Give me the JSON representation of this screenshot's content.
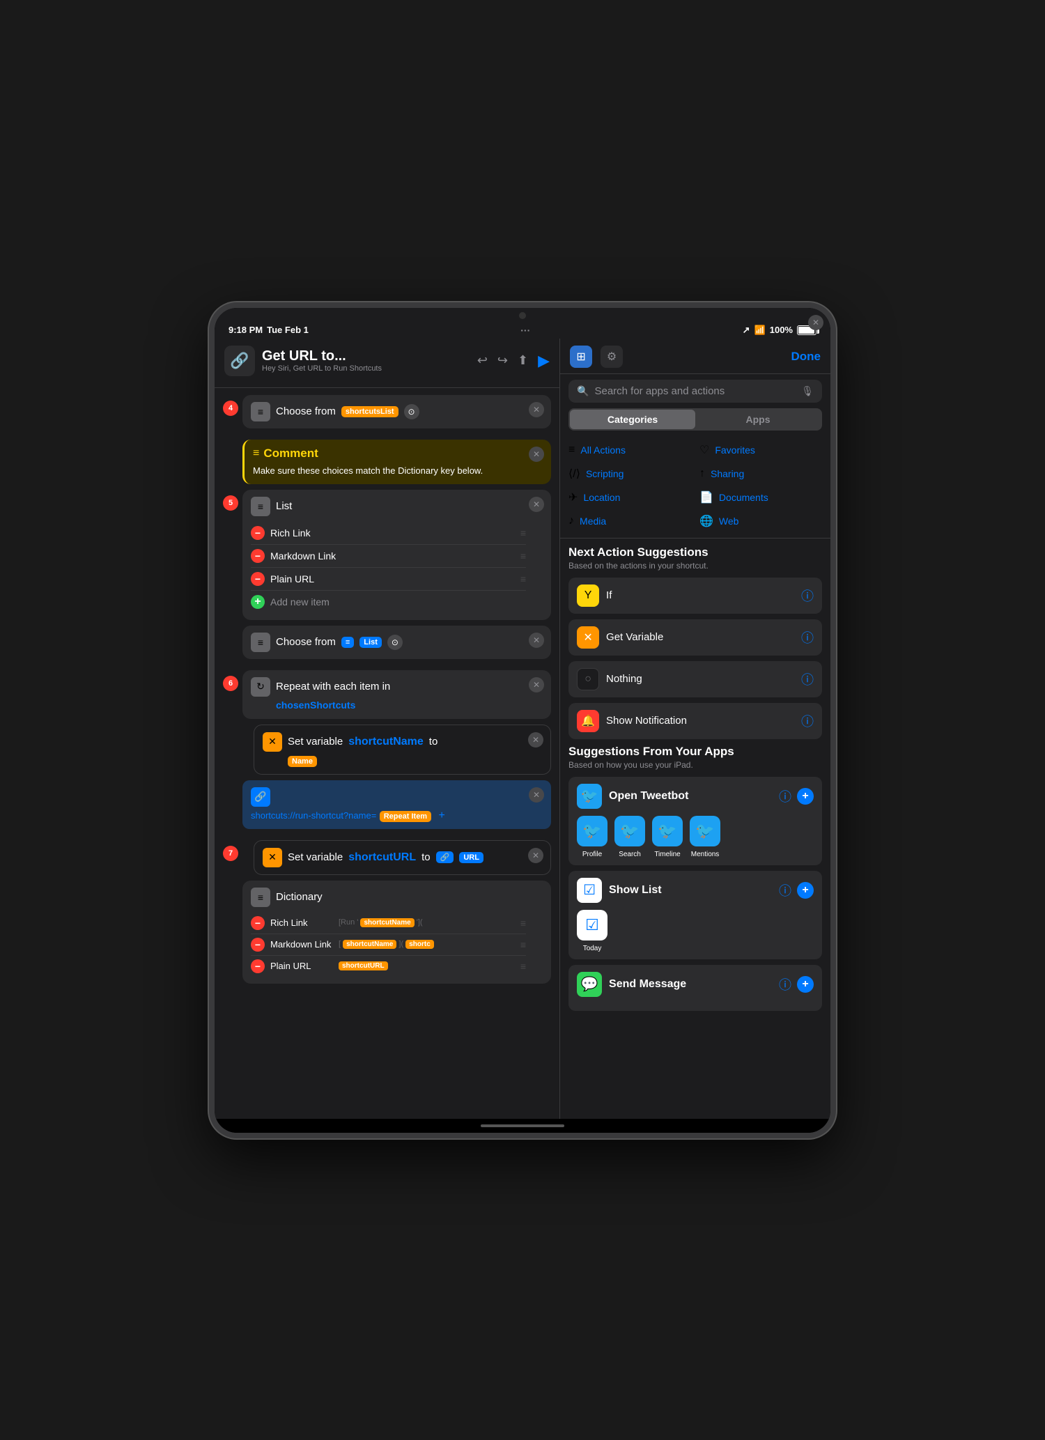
{
  "device": {
    "time": "9:18 PM",
    "date": "Tue Feb 1",
    "battery": "100%",
    "dots": "···"
  },
  "left_panel": {
    "title": "Get URL to...",
    "subtitle": "Hey Siri, Get URL to Run Shortcuts",
    "icon": "🔗",
    "step4": "4",
    "step5": "5",
    "step6": "6",
    "step7": "7",
    "choose_from_label": "Choose from",
    "shortcuts_list_var": "shortcutsList",
    "comment_title": "Comment",
    "comment_text": "Make sure these choices match the Dictionary key below.",
    "list_title": "List",
    "list_items": [
      "Rich Link",
      "Markdown Link",
      "Plain URL"
    ],
    "add_item_label": "Add new item",
    "choose_from_list_label": "Choose from",
    "list_var": "List",
    "repeat_label": "Repeat with each item in",
    "repeat_var": "chosenShortcuts",
    "set_var1": "Set variable",
    "shortcut_name_var": "shortcutName",
    "to_label": "to",
    "name_label": "Name",
    "url_text": "shortcuts://run-shortcut?name=",
    "repeat_item_var": "Repeat Item",
    "set_var2": "Set variable",
    "shortcut_url_var": "shortcutURL",
    "to_label2": "to",
    "url_label": "URL",
    "dictionary_title": "Dictionary",
    "dict_items": [
      {
        "key": "Rich Link",
        "val": "[Run ' shortcutName ']("
      },
      {
        "key": "Markdown Link",
        "val": "[ shortcutName ]( shortc"
      },
      {
        "key": "Plain URL",
        "val": "shortcutURL"
      }
    ]
  },
  "right_panel": {
    "done_label": "Done",
    "search_placeholder": "Search for apps and actions",
    "tab_categories": "Categories",
    "tab_apps": "Apps",
    "categories": [
      {
        "icon": "≡",
        "label": "All Actions"
      },
      {
        "icon": "♡",
        "label": "Favorites"
      },
      {
        "icon": "⟨⟩",
        "label": "Scripting"
      },
      {
        "icon": "↑",
        "label": "Sharing"
      },
      {
        "icon": "✈",
        "label": "Location"
      },
      {
        "icon": "📄",
        "label": "Documents"
      },
      {
        "icon": "♪",
        "label": "Media"
      },
      {
        "icon": "🌐",
        "label": "Web"
      }
    ],
    "next_action_title": "Next Action Suggestions",
    "next_action_sub": "Based on the actions in your shortcut.",
    "suggestions": [
      {
        "icon": "Y",
        "icon_style": "yellow",
        "label": "If"
      },
      {
        "icon": "X",
        "icon_style": "orange",
        "label": "Get Variable"
      },
      {
        "icon": "○",
        "icon_style": "dark",
        "label": "Nothing"
      },
      {
        "icon": "🔔",
        "icon_style": "red",
        "label": "Show Notification"
      }
    ],
    "app_suggestions_title": "Suggestions From Your Apps",
    "app_suggestions_sub": "Based on how you use your iPad.",
    "apps": [
      {
        "name": "Open Tweetbot",
        "icon": "🐦",
        "icon_style": "tweetbot",
        "sub_actions": [
          {
            "label": "Profile",
            "icon": "🐦",
            "icon_style": "tweetbot"
          },
          {
            "label": "Search",
            "icon": "🐦",
            "icon_style": "tweetbot"
          },
          {
            "label": "Timeline",
            "icon": "🐦",
            "icon_style": "tweetbot"
          },
          {
            "label": "Mentions",
            "icon": "🐦",
            "icon_style": "tweetbot"
          }
        ]
      },
      {
        "name": "Show List",
        "icon": "☑",
        "icon_style": "showlist",
        "sub_actions": [
          {
            "label": "Today",
            "icon": "☑",
            "icon_style": "showlist"
          }
        ]
      },
      {
        "name": "Send Message",
        "icon": "💬",
        "icon_style": "sendmsg",
        "sub_actions": []
      }
    ]
  }
}
